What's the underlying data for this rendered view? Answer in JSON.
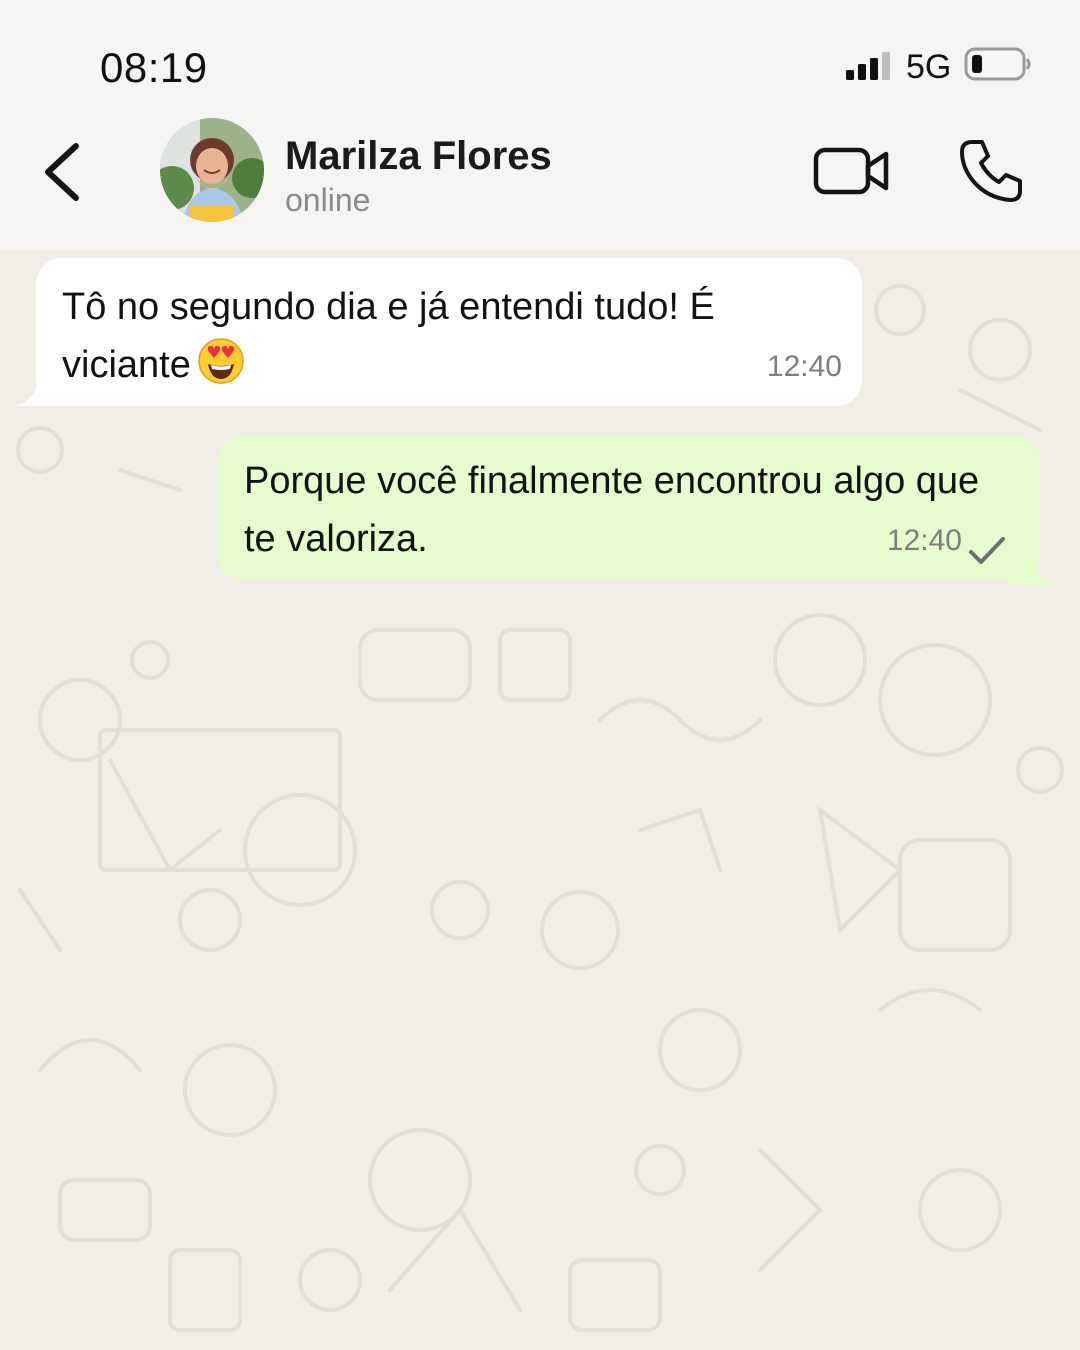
{
  "status_bar": {
    "time": "08:19",
    "network": "5G",
    "signal_icon": "signal-bars-icon",
    "battery_icon": "battery-low-icon"
  },
  "header": {
    "contact_name": "Marilza Flores",
    "contact_status": "online",
    "back_icon": "chevron-left-icon",
    "video_icon": "video-camera-icon",
    "call_icon": "phone-icon"
  },
  "messages": [
    {
      "direction": "incoming",
      "text": "Tô no segundo dia e já entendi tudo! É viciante",
      "emoji": "smiling-face-with-heart-eyes",
      "time": "12:40"
    },
    {
      "direction": "outgoing",
      "text": "Porque você finalmente encontrou algo que te valoriza.",
      "time": "12:40",
      "status": "sent"
    }
  ],
  "colors": {
    "incoming_bubble": "#ffffff",
    "outgoing_bubble": "#e6fccf",
    "chat_background": "#f1eee7",
    "header_background": "#f6f5f3"
  }
}
